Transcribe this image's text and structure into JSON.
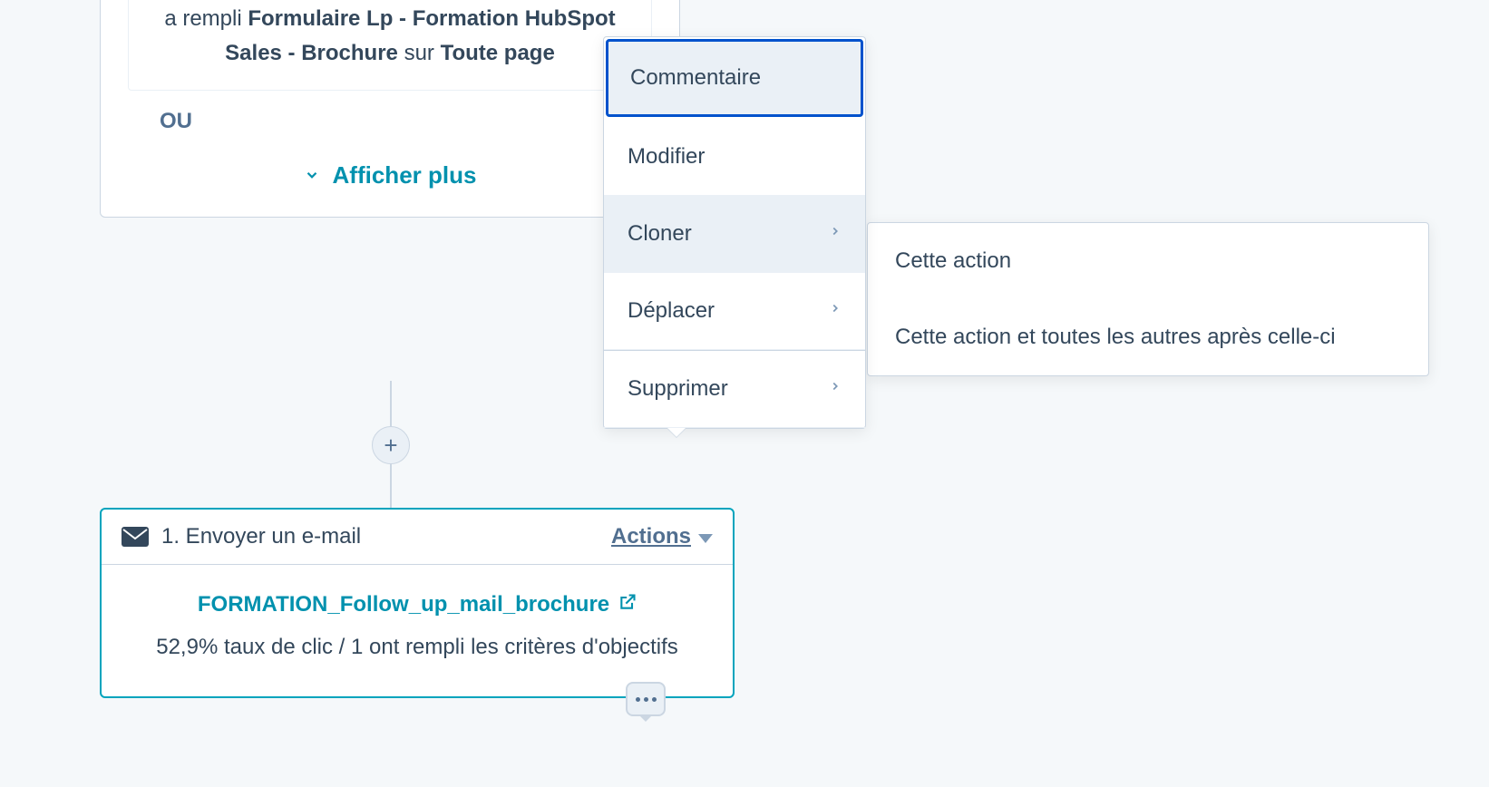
{
  "trigger": {
    "prefix": "a rempli",
    "form_name": "Formulaire Lp - Formation HubSpot Sales - Brochure",
    "middle": "sur",
    "page_ref": "Toute page",
    "or_label": "OU",
    "show_more": "Afficher plus"
  },
  "action": {
    "step_label": "1. Envoyer un e-mail",
    "actions_label": "Actions",
    "mail_name": "FORMATION_Follow_up_mail_brochure",
    "stats": "52,9% taux de clic / 1 ont rempli les critères d'objectifs"
  },
  "dropdown": {
    "comment": "Commentaire",
    "edit": "Modifier",
    "clone": "Cloner",
    "move": "Déplacer",
    "delete": "Supprimer"
  },
  "submenu": {
    "this_action": "Cette action",
    "this_and_after": "Cette action et toutes les autres après celle-ci"
  }
}
